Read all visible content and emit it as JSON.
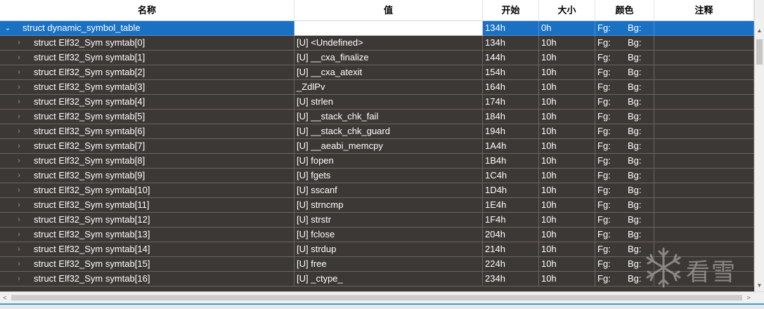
{
  "columns": {
    "name": "名称",
    "value": "值",
    "start": "开始",
    "size": "大小",
    "color": "颜色",
    "comment": "注释"
  },
  "rows": [
    {
      "name": "struct dynamic_symbol_table",
      "value": "",
      "start": "134h",
      "size": "0h",
      "fg": "Fg:",
      "bg": "Bg:",
      "expander": "⌄",
      "level": 0,
      "selected": true
    },
    {
      "name": "struct Elf32_Sym symtab[0]",
      "value": "[U] <Undefined>",
      "start": "134h",
      "size": "10h",
      "fg": "Fg:",
      "bg": "Bg:",
      "expander": "›",
      "level": 1
    },
    {
      "name": "struct Elf32_Sym symtab[1]",
      "value": "[U] __cxa_finalize",
      "start": "144h",
      "size": "10h",
      "fg": "Fg:",
      "bg": "Bg:",
      "expander": "›",
      "level": 1
    },
    {
      "name": "struct Elf32_Sym symtab[2]",
      "value": "[U] __cxa_atexit",
      "start": "154h",
      "size": "10h",
      "fg": "Fg:",
      "bg": "Bg:",
      "expander": "›",
      "level": 1
    },
    {
      "name": "struct Elf32_Sym symtab[3]",
      "value": "_ZdlPv",
      "start": "164h",
      "size": "10h",
      "fg": "Fg:",
      "bg": "Bg:",
      "expander": "›",
      "level": 1
    },
    {
      "name": "struct Elf32_Sym symtab[4]",
      "value": "[U] strlen",
      "start": "174h",
      "size": "10h",
      "fg": "Fg:",
      "bg": "Bg:",
      "expander": "›",
      "level": 1
    },
    {
      "name": "struct Elf32_Sym symtab[5]",
      "value": "[U] __stack_chk_fail",
      "start": "184h",
      "size": "10h",
      "fg": "Fg:",
      "bg": "Bg:",
      "expander": "›",
      "level": 1
    },
    {
      "name": "struct Elf32_Sym symtab[6]",
      "value": "[U] __stack_chk_guard",
      "start": "194h",
      "size": "10h",
      "fg": "Fg:",
      "bg": "Bg:",
      "expander": "›",
      "level": 1
    },
    {
      "name": "struct Elf32_Sym symtab[7]",
      "value": "[U] __aeabi_memcpy",
      "start": "1A4h",
      "size": "10h",
      "fg": "Fg:",
      "bg": "Bg:",
      "expander": "›",
      "level": 1
    },
    {
      "name": "struct Elf32_Sym symtab[8]",
      "value": "[U] fopen",
      "start": "1B4h",
      "size": "10h",
      "fg": "Fg:",
      "bg": "Bg:",
      "expander": "›",
      "level": 1
    },
    {
      "name": "struct Elf32_Sym symtab[9]",
      "value": "[U] fgets",
      "start": "1C4h",
      "size": "10h",
      "fg": "Fg:",
      "bg": "Bg:",
      "expander": "›",
      "level": 1
    },
    {
      "name": "struct Elf32_Sym symtab[10]",
      "value": "[U] sscanf",
      "start": "1D4h",
      "size": "10h",
      "fg": "Fg:",
      "bg": "Bg:",
      "expander": "›",
      "level": 1
    },
    {
      "name": "struct Elf32_Sym symtab[11]",
      "value": "[U] strncmp",
      "start": "1E4h",
      "size": "10h",
      "fg": "Fg:",
      "bg": "Bg:",
      "expander": "›",
      "level": 1
    },
    {
      "name": "struct Elf32_Sym symtab[12]",
      "value": "[U] strstr",
      "start": "1F4h",
      "size": "10h",
      "fg": "Fg:",
      "bg": "Bg:",
      "expander": "›",
      "level": 1
    },
    {
      "name": "struct Elf32_Sym symtab[13]",
      "value": "[U] fclose",
      "start": "204h",
      "size": "10h",
      "fg": "Fg:",
      "bg": "Bg:",
      "expander": "›",
      "level": 1
    },
    {
      "name": "struct Elf32_Sym symtab[14]",
      "value": "[U] strdup",
      "start": "214h",
      "size": "10h",
      "fg": "Fg:",
      "bg": "Bg:",
      "expander": "›",
      "level": 1
    },
    {
      "name": "struct Elf32_Sym symtab[15]",
      "value": "[U] free",
      "start": "224h",
      "size": "10h",
      "fg": "Fg:",
      "bg": "Bg:",
      "expander": "›",
      "level": 1
    },
    {
      "name": "struct Elf32_Sym symtab[16]",
      "value": "[U] _ctype_",
      "start": "234h",
      "size": "10h",
      "fg": "Fg:",
      "bg": "Bg:",
      "expander": "›",
      "level": 1
    }
  ],
  "scrollbars": {
    "up_icon": "triangle-up",
    "down_icon": "triangle-down",
    "left_icon": "chevron-left",
    "right_icon": "chevron-right"
  },
  "status_bar": {
    "text": ""
  },
  "watermark": {
    "text": "看雪",
    "icon": "snowflake-icon"
  },
  "colors": {
    "grid_bg": "#3c3836",
    "selected_row": "#1a71c4",
    "header_bg": "#ffffff",
    "grid_line": "#6a6562"
  }
}
